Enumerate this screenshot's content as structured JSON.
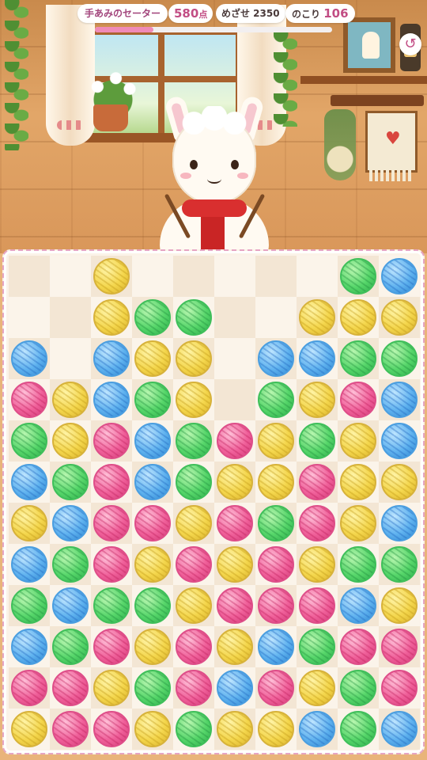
{
  "hud": {
    "title": "手あみのセーター",
    "score_value": "580",
    "score_unit": "点",
    "goal_label": "めざせ 2350",
    "moves_label": "のこり",
    "moves_value": "106",
    "progress_fraction": 0.247
  },
  "colors": {
    "yellow": "#f4d64c",
    "green": "#56d66a",
    "blue": "#5fb2ef",
    "pink": "#f0609a",
    "accent_pink": "#c24d84"
  },
  "board": {
    "columns": 10,
    "rows": 12,
    "grid": [
      [
        null,
        null,
        "yellow",
        null,
        null,
        null,
        null,
        null,
        "green",
        "blue"
      ],
      [
        null,
        null,
        "yellow",
        "green",
        "green",
        null,
        null,
        "yellow",
        "yellow",
        "yellow"
      ],
      [
        "blue",
        null,
        "blue",
        "yellow",
        "yellow",
        null,
        "blue",
        "blue",
        "green",
        "green"
      ],
      [
        "pink",
        "yellow",
        "blue",
        "green",
        "yellow",
        null,
        "green",
        "yellow",
        "pink",
        "blue"
      ],
      [
        "green",
        "yellow",
        "pink",
        "blue",
        "green",
        "pink",
        "yellow",
        "green",
        "yellow",
        "blue"
      ],
      [
        "blue",
        "green",
        "pink",
        "blue",
        "green",
        "yellow",
        "yellow",
        "pink",
        "yellow",
        "yellow"
      ],
      [
        "yellow",
        "blue",
        "pink",
        "pink",
        "yellow",
        "pink",
        "green",
        "pink",
        "yellow",
        "blue"
      ],
      [
        "blue",
        "green",
        "pink",
        "yellow",
        "pink",
        "yellow",
        "pink",
        "yellow",
        "green",
        "green"
      ],
      [
        "green",
        "blue",
        "green",
        "green",
        "yellow",
        "pink",
        "pink",
        "pink",
        "blue",
        "yellow"
      ],
      [
        "blue",
        "green",
        "pink",
        "yellow",
        "pink",
        "yellow",
        "blue",
        "green",
        "pink",
        "pink"
      ],
      [
        "pink",
        "pink",
        "yellow",
        "green",
        "pink",
        "blue",
        "pink",
        "yellow",
        "green",
        "pink"
      ],
      [
        "yellow",
        "pink",
        "pink",
        "yellow",
        "green",
        "yellow",
        "yellow",
        "blue",
        "green",
        "blue"
      ]
    ]
  }
}
